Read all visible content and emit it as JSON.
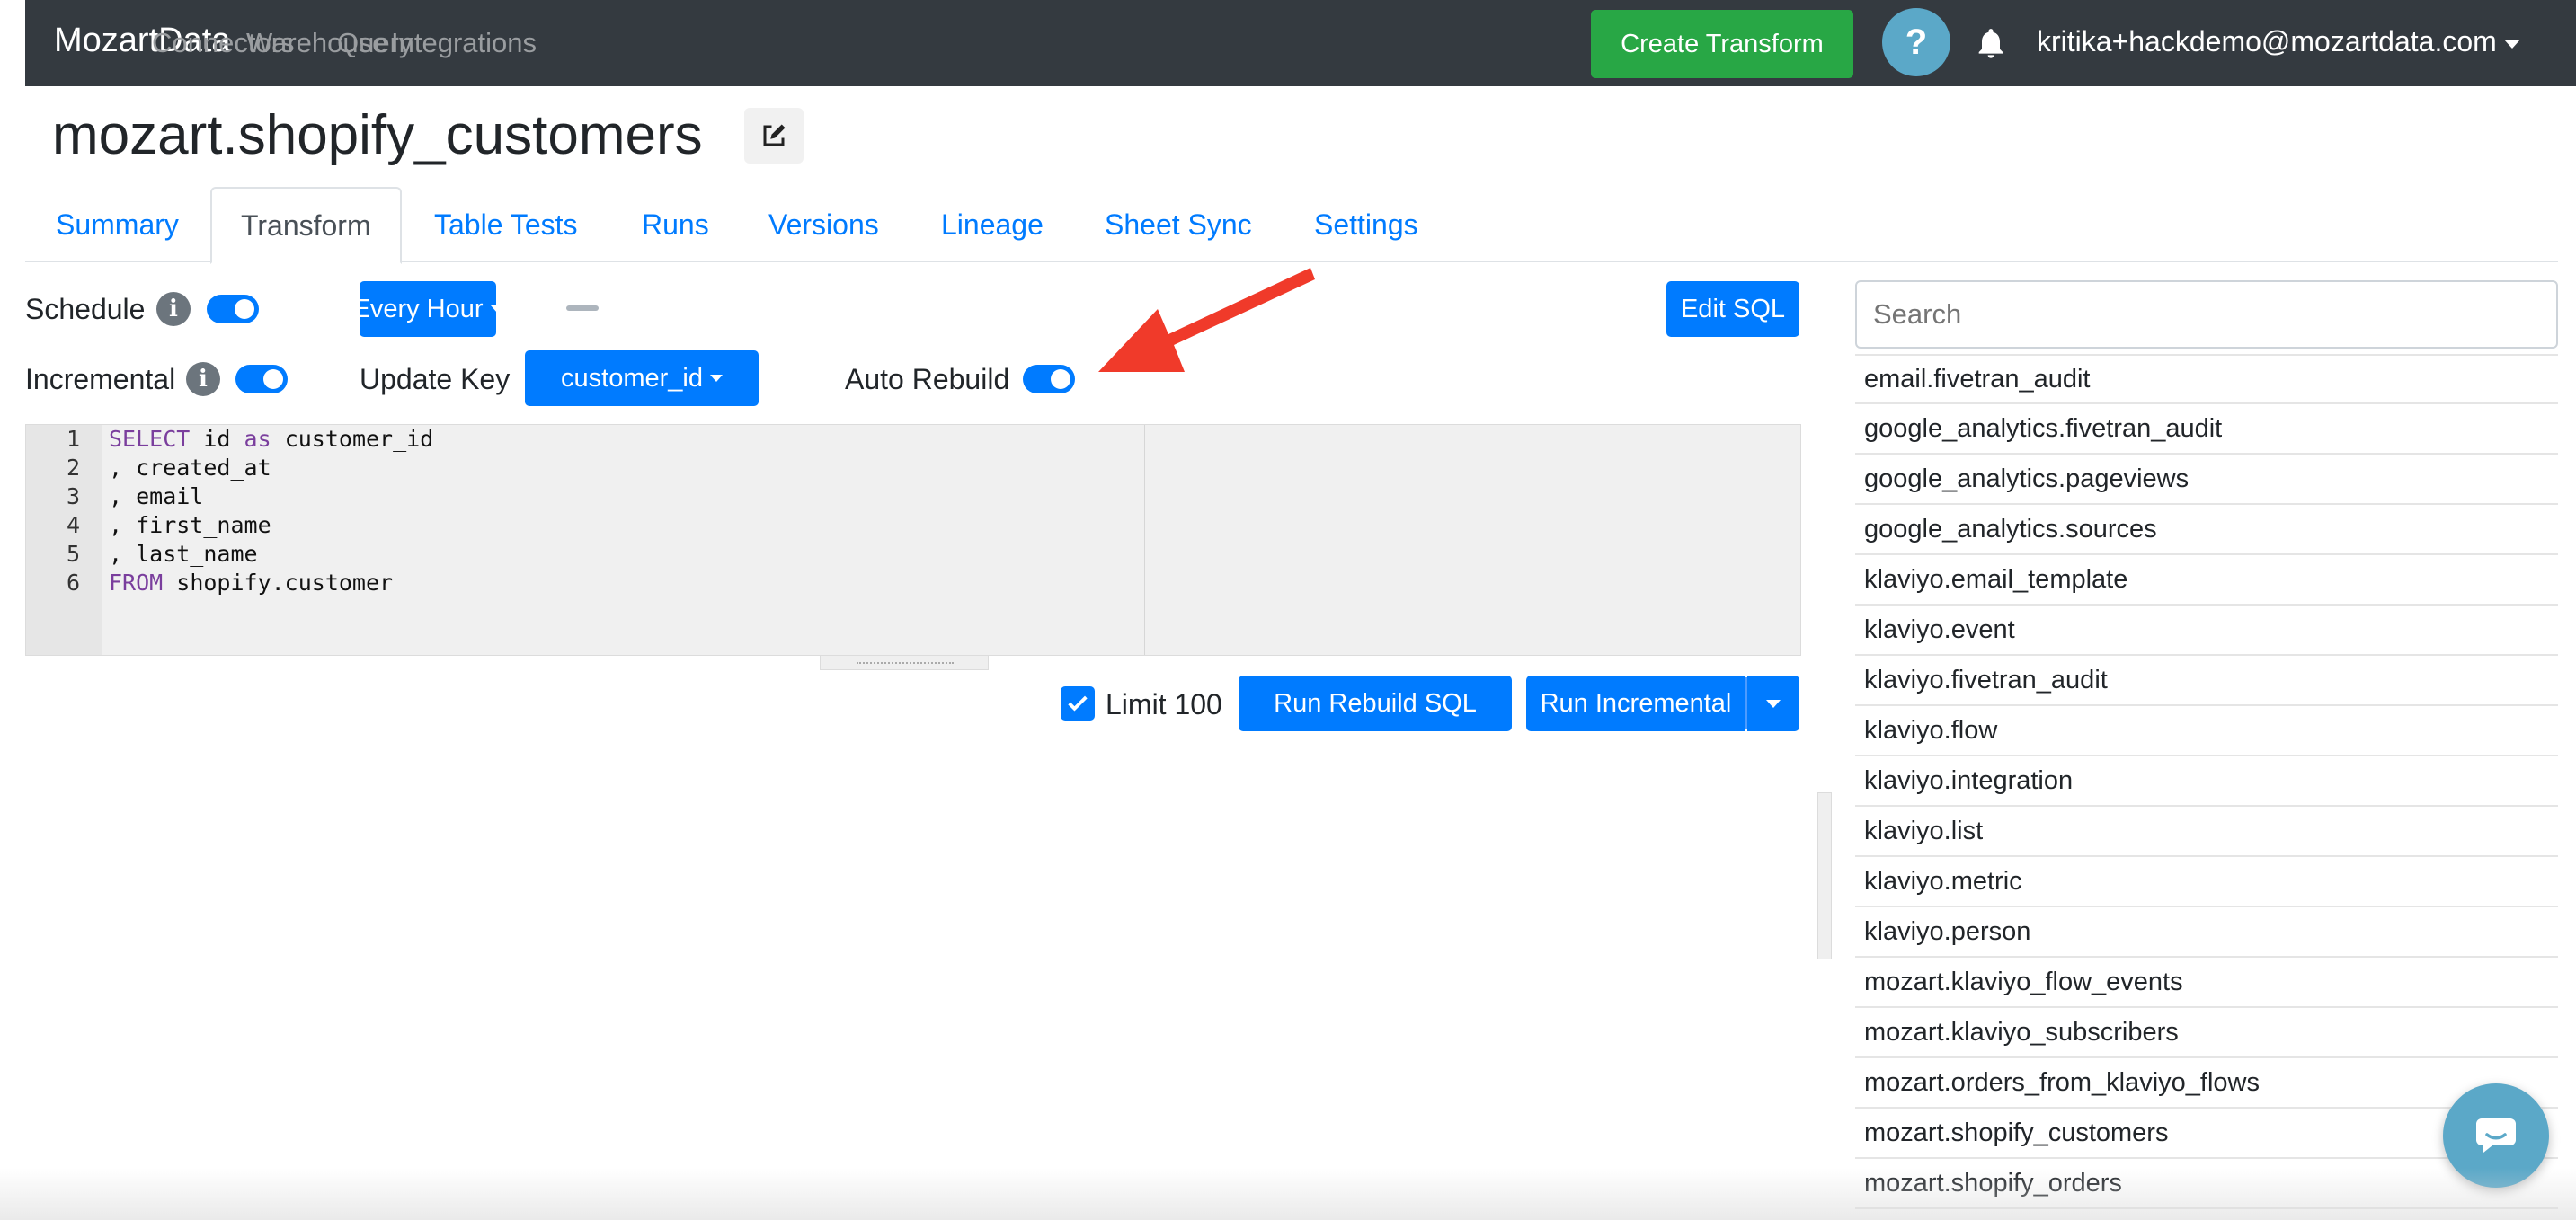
{
  "navbar": {
    "brand": "MozartData",
    "links": [
      "Connectors",
      "Warehouse",
      "Query",
      "Integrations"
    ],
    "create_button": "Create Transform",
    "help_label": "?",
    "user_email": "kritika+hackdemo@mozartdata.com"
  },
  "page": {
    "title": "mozart.shopify_customers"
  },
  "tabs": [
    {
      "label": "Summary",
      "active": false
    },
    {
      "label": "Transform",
      "active": true
    },
    {
      "label": "Table Tests",
      "active": false
    },
    {
      "label": "Runs",
      "active": false
    },
    {
      "label": "Versions",
      "active": false
    },
    {
      "label": "Lineage",
      "active": false
    },
    {
      "label": "Sheet Sync",
      "active": false
    },
    {
      "label": "Settings",
      "active": false
    }
  ],
  "controls": {
    "schedule_label": "Schedule",
    "schedule_on": true,
    "frequency": "Every Hour",
    "edit_sql_label": "Edit SQL",
    "incremental_label": "Incremental",
    "incremental_on": true,
    "update_key_label": "Update Key",
    "update_key_value": "customer_id",
    "auto_rebuild_label": "Auto Rebuild",
    "auto_rebuild_on": true
  },
  "editor": {
    "line_numbers": [
      "1",
      "2",
      "3",
      "4",
      "5",
      "6"
    ],
    "lines": [
      {
        "kw": "SELECT",
        "rest": " id ",
        "kw2": "as",
        "rest2": " customer_id"
      },
      {
        "kw": "",
        "rest": ", created_at",
        "kw2": "",
        "rest2": ""
      },
      {
        "kw": "",
        "rest": ", email",
        "kw2": "",
        "rest2": ""
      },
      {
        "kw": "",
        "rest": ", first_name",
        "kw2": "",
        "rest2": ""
      },
      {
        "kw": "",
        "rest": ", last_name",
        "kw2": "",
        "rest2": ""
      },
      {
        "kw": "FROM",
        "rest": " shopify.customer",
        "kw2": "",
        "rest2": ""
      }
    ]
  },
  "run_bar": {
    "limit_label": "Limit 100",
    "limit_checked": true,
    "rebuild_label": "Run Rebuild SQL",
    "incremental_label": "Run Incremental"
  },
  "sidebar": {
    "search_placeholder": "Search",
    "tables": [
      "email.fivetran_audit",
      "google_analytics.fivetran_audit",
      "google_analytics.pageviews",
      "google_analytics.sources",
      "klaviyo.email_template",
      "klaviyo.event",
      "klaviyo.fivetran_audit",
      "klaviyo.flow",
      "klaviyo.integration",
      "klaviyo.list",
      "klaviyo.metric",
      "klaviyo.person",
      "mozart.klaviyo_flow_events",
      "mozart.klaviyo_subscribers",
      "mozart.orders_from_klaviyo_flows",
      "mozart.shopify_customers",
      "mozart.shopify_orders"
    ]
  },
  "colors": {
    "navbar_bg": "#343a40",
    "primary": "#007bff",
    "success": "#28a745",
    "annotation_arrow": "#f03a2a",
    "help_bg": "#5ba8c8"
  },
  "icons": {
    "edit": "edit-icon",
    "info": "info-icon",
    "bell": "bell-icon",
    "chat": "chat-icon",
    "check": "check-icon"
  }
}
